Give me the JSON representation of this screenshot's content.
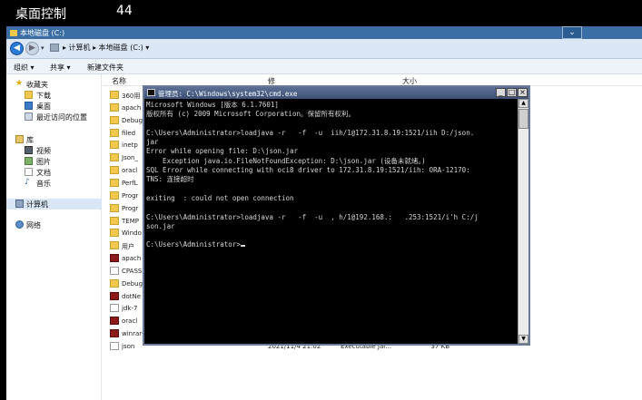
{
  "remote": {
    "title": "桌面控制",
    "tail": "44"
  },
  "explorer": {
    "window_title": "本地磁盘 (C:)",
    "collapse_icon": "⌄",
    "address": "▸ 计算机 ▸ 本地磁盘 (C:) ▾",
    "toolbar": {
      "organize": "组织 ▾",
      "share": "共享 ▾",
      "new_folder": "新建文件夹"
    },
    "nav": {
      "favorites": "收藏夹",
      "downloads": "下载",
      "desktop": "桌面",
      "recent": "最近访问的位置",
      "libraries": "库",
      "videos": "视频",
      "pictures": "图片",
      "documents": "文档",
      "music": "音乐",
      "computer": "计算机",
      "network": "网络"
    },
    "columns": {
      "name": "名称",
      "date": "修",
      "type": "",
      "size": "大小"
    },
    "files": [
      {
        "name": "360用",
        "date": "",
        "type": "",
        "size": "",
        "icon": "folder"
      },
      {
        "name": "apach",
        "date": "",
        "type": "",
        "size": "",
        "icon": "folder"
      },
      {
        "name": "Debug",
        "date": "",
        "type": "",
        "size": "",
        "icon": "folder"
      },
      {
        "name": "filed",
        "date": "",
        "type": "",
        "size": "",
        "icon": "folder"
      },
      {
        "name": "inetp",
        "date": "",
        "type": "",
        "size": "",
        "icon": "folder"
      },
      {
        "name": "Json_",
        "date": "",
        "type": "",
        "size": "",
        "icon": "folder"
      },
      {
        "name": "oracl",
        "date": "",
        "type": "",
        "size": "",
        "icon": "folder"
      },
      {
        "name": "PerfL",
        "date": "",
        "type": "",
        "size": "",
        "icon": "folder"
      },
      {
        "name": "Progr",
        "date": "",
        "type": "",
        "size": "",
        "icon": "folder"
      },
      {
        "name": "Progr",
        "date": "",
        "type": "",
        "size": "",
        "icon": "folder"
      },
      {
        "name": "TEMP",
        "date": "",
        "type": "",
        "size": "",
        "icon": "folder"
      },
      {
        "name": "Windo",
        "date": "",
        "type": "",
        "size": "",
        "icon": "folder"
      },
      {
        "name": "用户",
        "date": "",
        "type": "",
        "size": "",
        "icon": "folder"
      },
      {
        "name": "apach",
        "date": "",
        "type": "",
        "size": "",
        "icon": "exe"
      },
      {
        "name": "CPASS",
        "date": "",
        "type": "",
        "size": "",
        "icon": "doc"
      },
      {
        "name": "Debug",
        "date": "",
        "type": "",
        "size": "",
        "icon": "folder"
      },
      {
        "name": "dotNe",
        "date": "",
        "type": "",
        "size": "",
        "icon": "exe"
      },
      {
        "name": "jdk-7",
        "date": "",
        "type": "",
        "size": "",
        "icon": "doc"
      },
      {
        "name": "oracl",
        "date": "",
        "type": "",
        "size": "",
        "icon": "exe"
      },
      {
        "name": "winrar-x64-571scp",
        "date": "2021/3/11 9:36",
        "type": "应用程序",
        "size": "3,187 KB",
        "icon": "exe"
      },
      {
        "name": "json",
        "date": "2021/11/4 21:02",
        "type": "Executable Jar...",
        "size": "37 KB",
        "icon": "doc"
      }
    ]
  },
  "cmd": {
    "title": "管理员: C:\\Windows\\system32\\cmd.exe",
    "min": "_",
    "max": "□",
    "close": "×",
    "lines": [
      "Microsoft Windows [版本 6.1.7601]",
      "版权所有 (c) 2009 Microsoft Corporation。保留所有权利。",
      "",
      "C:\\Users\\Administrator>loadjava -r   -f  -u  iih/1@172.31.8.19:1521/iih D:/json.",
      "jar",
      "Error while opening file: D:\\json.jar",
      "    Exception java.io.FileNotFoundException: D:\\json.jar (设备未就绪。)",
      "SQL Error while connecting with oci8 driver to 172.31.8.19:1521/iih: ORA-12170:",
      "TNS: 连接超时",
      "",
      "exiting  : could not open connection",
      "",
      "C:\\Users\\Administrator>loadjava -r   -f  -u  , h/1@192.168.:   .253:1521/i'h C:/j",
      "son.jar",
      "",
      "C:\\Users\\Administrator>"
    ]
  }
}
